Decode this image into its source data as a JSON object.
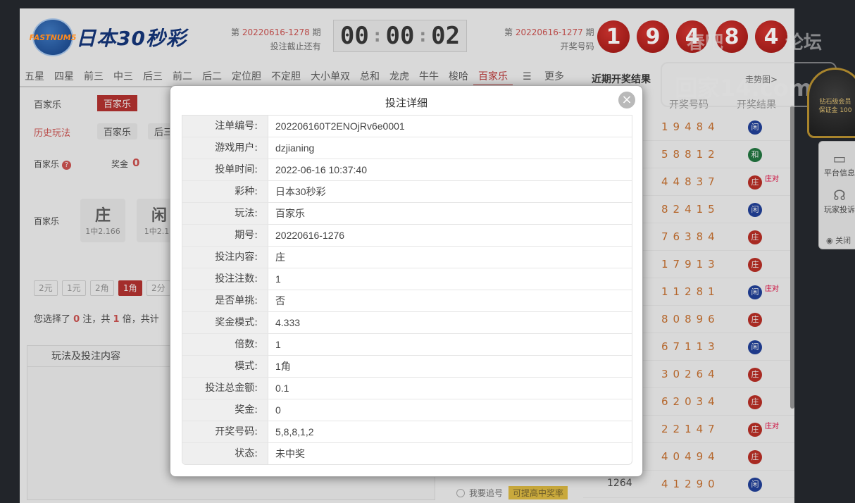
{
  "app": {
    "logo_badge": "FASTNUM5",
    "logo_text": "日本30秒彩"
  },
  "current_issue": {
    "prefix": "第",
    "number": "20220616-1278",
    "suffix": "期",
    "deadline_label": "投注截止还有",
    "timer": {
      "h": "00",
      "m": "00",
      "s": "02"
    }
  },
  "last_issue": {
    "prefix": "第",
    "number": "20220616-1277",
    "suffix": "期",
    "label": "开奖号码",
    "balls": [
      "1",
      "9",
      "4",
      "8",
      "4"
    ]
  },
  "nav_tabs": [
    "五星",
    "四星",
    "前三",
    "中三",
    "后三",
    "前二",
    "后二",
    "定位胆",
    "不定胆",
    "大小单双",
    "总和",
    "龙虎",
    "牛牛",
    "梭哈",
    "百家乐"
  ],
  "nav_active": "百家乐",
  "nav_more": "更多",
  "side": {
    "title": "近期开奖结果",
    "trend": "走势图>",
    "col_code": "开奖号码",
    "col_result": "开奖结果",
    "rows": [
      {
        "issue": "",
        "code": "19484",
        "result": "闲",
        "color": "blue",
        "pair": ""
      },
      {
        "issue": "",
        "code": "58812",
        "result": "和",
        "color": "green",
        "pair": ""
      },
      {
        "issue": "",
        "code": "44837",
        "result": "庄",
        "color": "red",
        "pair": "庄对"
      },
      {
        "issue": "",
        "code": "82415",
        "result": "闲",
        "color": "blue",
        "pair": ""
      },
      {
        "issue": "",
        "code": "76384",
        "result": "庄",
        "color": "red",
        "pair": ""
      },
      {
        "issue": "",
        "code": "17913",
        "result": "庄",
        "color": "red",
        "pair": ""
      },
      {
        "issue": "",
        "code": "11281",
        "result": "闲",
        "color": "blue",
        "pair": "庄对"
      },
      {
        "issue": "",
        "code": "80896",
        "result": "庄",
        "color": "red",
        "pair": ""
      },
      {
        "issue": "",
        "code": "67113",
        "result": "闲",
        "color": "blue",
        "pair": ""
      },
      {
        "issue": "",
        "code": "30264",
        "result": "庄",
        "color": "red",
        "pair": ""
      },
      {
        "issue": "",
        "code": "62034",
        "result": "庄",
        "color": "red",
        "pair": ""
      },
      {
        "issue": "",
        "code": "22147",
        "result": "庄",
        "color": "red",
        "pair": "庄对"
      },
      {
        "issue": "",
        "code": "40494",
        "result": "庄",
        "color": "red",
        "pair": ""
      },
      {
        "issue": "1264",
        "code": "41290",
        "result": "闲",
        "color": "blue",
        "pair": ""
      }
    ]
  },
  "play": {
    "sub_label": "百家乐",
    "sub_tag": "百家乐",
    "history_label": "历史玩法",
    "history_tags": [
      "百家乐",
      "后三"
    ],
    "bac_label": "百家乐",
    "bonus_label": "奖金",
    "bonus_value": "0",
    "bet_row_label": "百家乐",
    "cards": [
      {
        "title": "庄",
        "odds": "1中2.166"
      },
      {
        "title": "闲",
        "odds": "1中2.16"
      }
    ],
    "units": [
      "2元",
      "1元",
      "2角",
      "1角",
      "2分"
    ],
    "unit_active": "1角",
    "summary": {
      "t1": "您选择了",
      "n1": "0",
      "t2": "注，共",
      "n2": "1",
      "t3": "倍，共计"
    },
    "panel_title": "玩法及投注内容",
    "chase_label": "我要追号",
    "chase_tip": "可提高中奖率"
  },
  "watermark": {
    "text1": "春吧",
    "text2": "论坛",
    "text3": "回家14.com"
  },
  "seal": {
    "line1": "钻石级会员",
    "line2": "保证金 100"
  },
  "float_panel": {
    "item1": "平台信息",
    "item2": "玩家投诉",
    "close": "关闭"
  },
  "modal": {
    "title": "投注详细",
    "close_glyph": "×",
    "rows": [
      {
        "label": "注单编号:",
        "value": "202206160T2ENOjRv6e0001"
      },
      {
        "label": "游戏用户:",
        "value": "dzjianing"
      },
      {
        "label": "投单时间:",
        "value": "2022-06-16 10:37:40"
      },
      {
        "label": "彩种:",
        "value": "日本30秒彩"
      },
      {
        "label": "玩法:",
        "value": "百家乐"
      },
      {
        "label": "期号:",
        "value": "20220616-1276"
      },
      {
        "label": "投注内容:",
        "value": "庄"
      },
      {
        "label": "投注注数:",
        "value": "1"
      },
      {
        "label": "是否单挑:",
        "value": "否"
      },
      {
        "label": "奖金模式:",
        "value": "4.333"
      },
      {
        "label": "倍数:",
        "value": "1"
      },
      {
        "label": "模式:",
        "value": "1角"
      },
      {
        "label": "投注总金额:",
        "value": "0.1"
      },
      {
        "label": "奖金:",
        "value": "0"
      },
      {
        "label": "开奖号码:",
        "value": "5,8,8,1,2"
      },
      {
        "label": "状态:",
        "value": "未中奖"
      }
    ]
  }
}
